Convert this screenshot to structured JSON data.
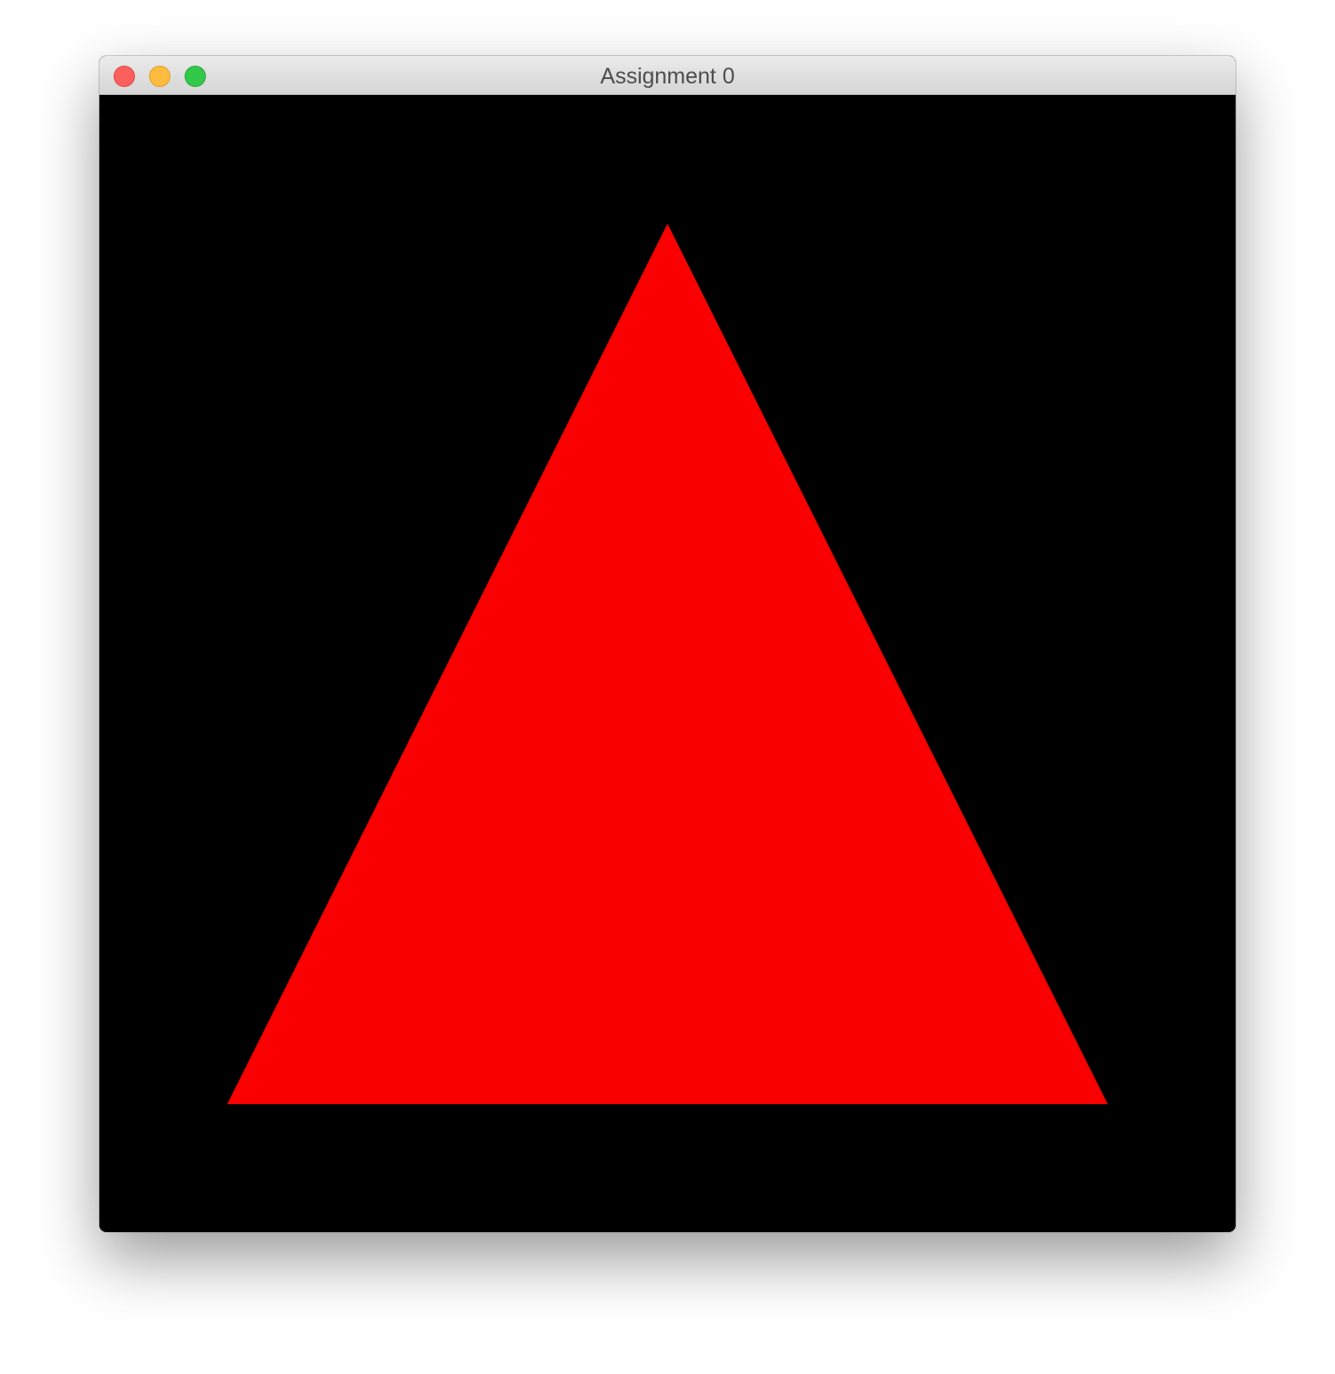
{
  "window": {
    "title": "Assignment 0",
    "controls": [
      "close",
      "minimize",
      "zoom"
    ]
  },
  "canvas": {
    "background": "#000000",
    "shape": "triangle",
    "fill": "#fa0000"
  }
}
